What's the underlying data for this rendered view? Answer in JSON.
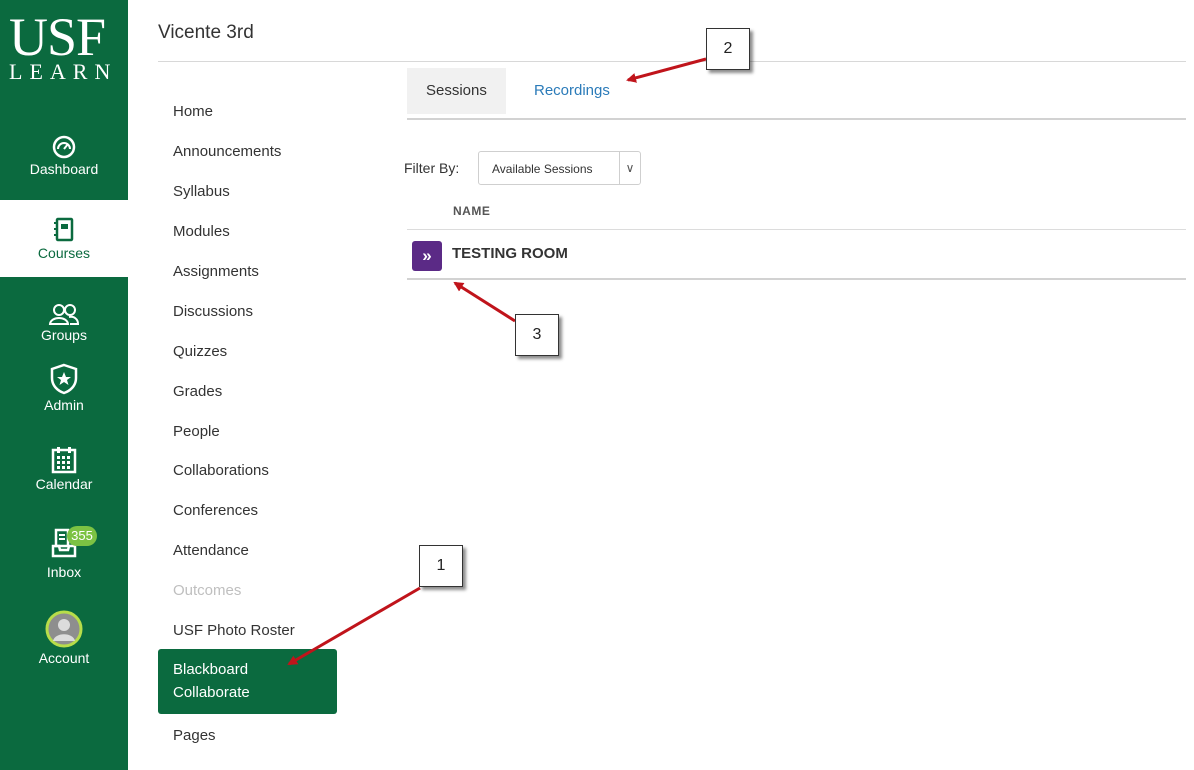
{
  "global_nav": {
    "logo_main": "USF",
    "logo_sub": "LEARN",
    "items": [
      {
        "label": "Dashboard",
        "icon": "dashboard-icon"
      },
      {
        "label": "Courses",
        "icon": "courses-icon"
      },
      {
        "label": "Groups",
        "icon": "groups-icon"
      },
      {
        "label": "Admin",
        "icon": "admin-icon"
      },
      {
        "label": "Calendar",
        "icon": "calendar-icon"
      },
      {
        "label": "Inbox",
        "icon": "inbox-icon",
        "badge": "355"
      },
      {
        "label": "Account",
        "icon": "account-avatar-icon"
      }
    ],
    "colors": {
      "brand_green": "#0b6a3f",
      "badge_green": "#7cc243"
    }
  },
  "course": {
    "title": "Vicente 3rd",
    "nav": [
      "Home",
      "Announcements",
      "Syllabus",
      "Modules",
      "Assignments",
      "Discussions",
      "Quizzes",
      "Grades",
      "People",
      "Collaborations",
      "Conferences",
      "Attendance",
      "Outcomes",
      "USF Photo Roster",
      "Blackboard Collaborate",
      "Pages"
    ],
    "active": "Blackboard Collaborate",
    "disabled": [
      "Outcomes"
    ]
  },
  "collaborate": {
    "tabs": [
      "Sessions",
      "Recordings"
    ],
    "active_tab": "Sessions",
    "filter_label": "Filter By:",
    "filter_value": "Available Sessions",
    "column_header": "NAME",
    "sessions": [
      {
        "name": "TESTING ROOM",
        "icon": "join-session-icon"
      }
    ],
    "colors": {
      "link_blue": "#2b7bb9",
      "session_purple": "#5b2a86"
    }
  },
  "callouts": [
    "1",
    "2",
    "3"
  ],
  "annotation_color": "#c0141b"
}
